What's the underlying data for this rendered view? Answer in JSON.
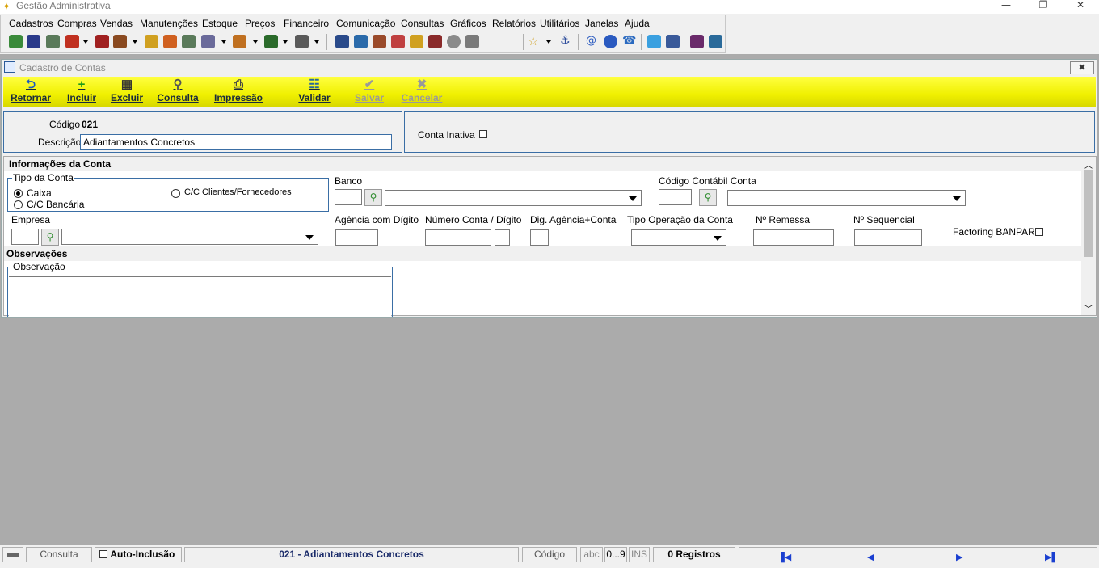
{
  "window": {
    "title": "Gestão Administrativa",
    "min_glyph": "—",
    "max_glyph": "❐",
    "close_glyph": "✕"
  },
  "menu": [
    "Cadastros",
    "Compras",
    "Vendas",
    "Manutenções",
    "Estoque",
    "Preços",
    "Financeiro",
    "Comunicação",
    "Consultas",
    "Gráficos",
    "Relatórios",
    "Utilitários",
    "Janelas",
    "Ajuda"
  ],
  "child": {
    "title": "Cadastro de Contas",
    "close_glyph": "✖"
  },
  "actions": {
    "retornar": "Retornar",
    "incluir": "Incluir",
    "excluir": "Excluir",
    "consulta": "Consulta",
    "impressao": "Impressão",
    "validar": "Validar",
    "salvar": "Salvar",
    "cancelar": "Cancelar"
  },
  "header": {
    "codigo_label": "Código",
    "codigo_value": "021",
    "descricao_label": "Descrição",
    "descricao_value": "Adiantamentos Concretos",
    "inativa_label": "Conta Inativa"
  },
  "info": {
    "section_title": "Informações da Conta",
    "tipo_group": "Tipo da Conta",
    "tipo_options": [
      "Caixa",
      "C/C Clientes/Fornecedores",
      "C/C Bancária"
    ],
    "tipo_selected": "Caixa",
    "banco_label": "Banco",
    "codigo_contabil_label": "Código Contábil Conta",
    "empresa_label": "Empresa",
    "agencia_label": "Agência com Dígito",
    "numero_conta_label": "Número Conta / Dígito",
    "dig_agencia_label": "Dig. Agência+Conta",
    "tipo_operacao_label": "Tipo Operação da Conta",
    "remessa_label": "Nº Remessa",
    "sequencial_label": "Nº Sequencial",
    "factoring_label": "Factoring BANPAR"
  },
  "obs": {
    "section_title": "Observações",
    "group_title": "Observação"
  },
  "status": {
    "mode": "Consulta",
    "auto_inclusao": "Auto-Inclusão",
    "record": "021 - Adiantamentos Concretos",
    "sort_field": "Código",
    "abc": "abc",
    "num": "0...9",
    "ins": "INS",
    "registros": "0 Registros"
  },
  "colors": {
    "accent_yellow": "#f0f000",
    "panel_border": "#3a6ea5",
    "nav_blue": "#1a3fd0"
  }
}
